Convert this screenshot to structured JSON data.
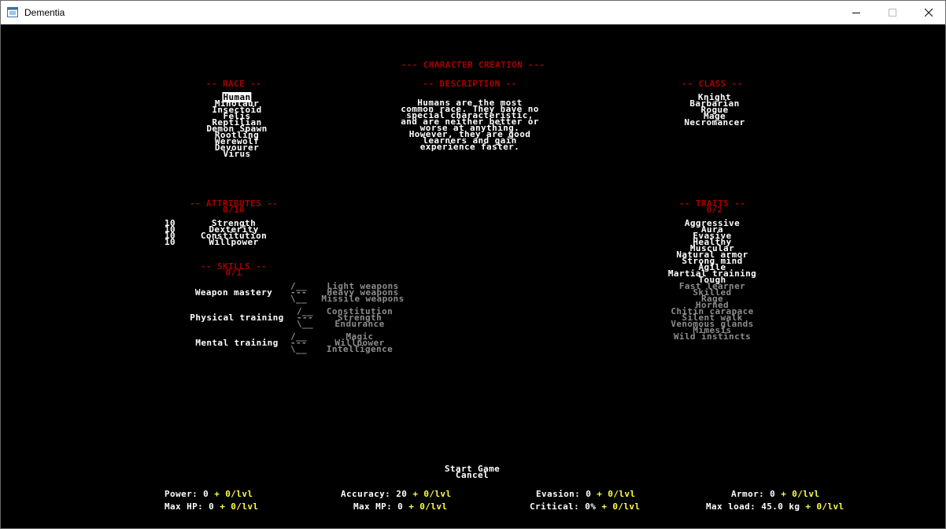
{
  "window": {
    "title": "Dementia"
  },
  "header": {
    "title": "--- CHARACTER CREATION ---"
  },
  "race": {
    "heading": "-- RACE --",
    "selected_index": 0,
    "items": [
      "Human",
      "Minotaur",
      "Insectoid",
      "Felis",
      "Reptilian",
      "Demon Spawn",
      "Rootling",
      "Werewolf",
      "Devourer",
      "Virus"
    ]
  },
  "description": {
    "heading": "-- DESCRIPTION --",
    "lines": [
      "Humans are the most",
      "common race. They have no",
      "special characteristic,",
      "and are neither better or",
      "worse at anything.",
      "However, they are good",
      "learners and gain",
      "experience faster."
    ]
  },
  "class": {
    "heading": "-- CLASS --",
    "items": [
      "Knight",
      "Barbarian",
      "Rogue",
      "Mage",
      "Necromancer"
    ]
  },
  "attributes": {
    "heading": "-- ATTRIBUTES --",
    "points": "0/10",
    "items": [
      {
        "value": "10",
        "name": "Strength"
      },
      {
        "value": "10",
        "name": "Dexterity"
      },
      {
        "value": "10",
        "name": "Constitution"
      },
      {
        "value": "10",
        "name": "Willpower"
      }
    ]
  },
  "skills": {
    "heading": "-- SKILLS --",
    "points": "0/1",
    "groups": [
      {
        "name": "Weapon mastery",
        "options": [
          "Light weapons",
          "Heavy weapons",
          "Missile weapons"
        ]
      },
      {
        "name": "Physical training",
        "options": [
          "Constitution",
          "Strength",
          "Endurance"
        ]
      },
      {
        "name": "Mental training",
        "options": [
          "Magic",
          "Willpower",
          "Intelligence"
        ]
      }
    ]
  },
  "traits": {
    "heading": "-- TRAITS --",
    "points": "0/2",
    "available": [
      "Aggressive",
      "Aura",
      "Evasive",
      "Healthy",
      "Muscular",
      "Natural armor",
      "Strong mind",
      "Agile",
      "Martial training",
      "Tough"
    ],
    "unavailable": [
      "Fast learner",
      "Skilled",
      "Rage",
      "Horned",
      "Chitin carapace",
      "Silent walk",
      "Venomous glands",
      "Mimesis",
      "Wild instincts"
    ]
  },
  "menu": {
    "start": "Start Game",
    "cancel": "Cancel"
  },
  "stats": {
    "per_level": "+ 0/lvl",
    "power": "Power: 0",
    "accuracy": "Accuracy: 20",
    "evasion": "Evasion: 0",
    "armor": "Armor: 0",
    "max_hp": "Max HP: 0",
    "max_mp": "Max MP: 0",
    "critical": "Critical: 0%",
    "max_load": "Max load: 45.0 kg"
  },
  "colors": {
    "heading": "#a60000",
    "active_text": "#ffffff",
    "inactive_text": "#8c8c8c",
    "per_level": "#ffff40",
    "background": "#000000"
  }
}
